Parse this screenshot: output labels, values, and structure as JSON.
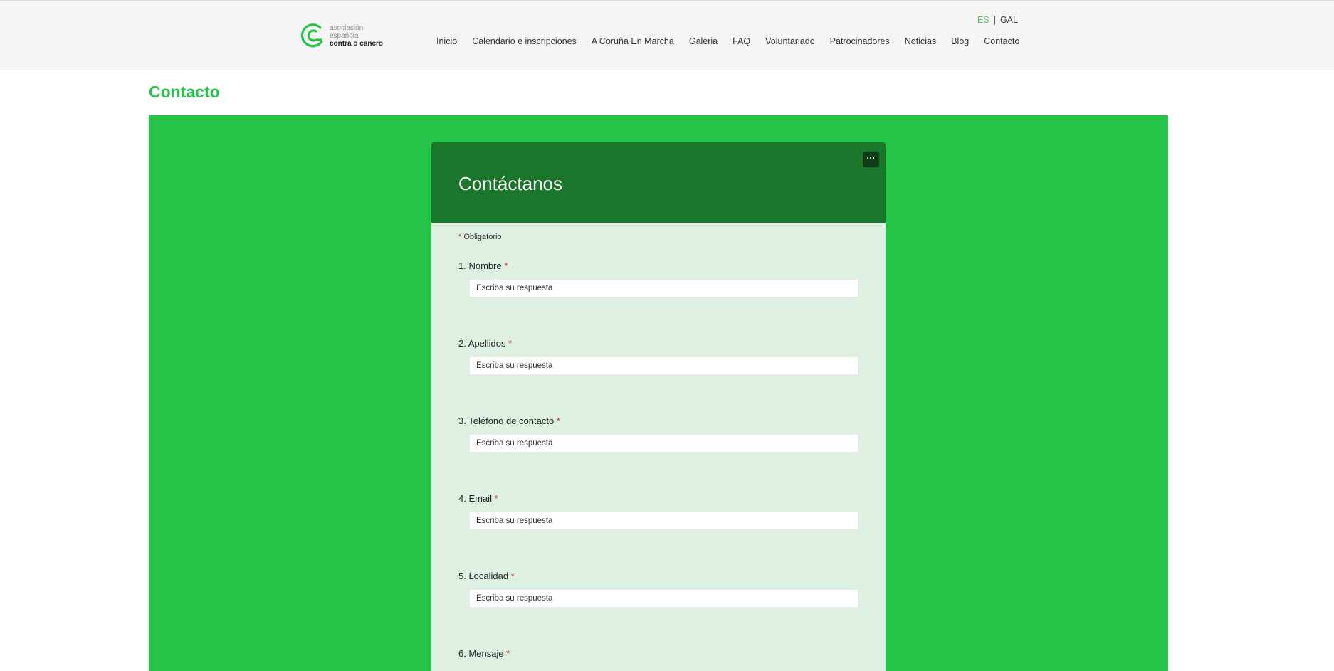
{
  "logo": {
    "line1": "asociación",
    "line2": "española",
    "line3": "contra o cancro",
    "brand_color": "#27c24a"
  },
  "language": {
    "active": "ES",
    "separator": "|",
    "other": "GAL"
  },
  "nav": [
    "Inicio",
    "Calendario e inscripciones",
    "A Coruña En Marcha",
    "Galeria",
    "FAQ",
    "Voluntariado",
    "Patrocinadores",
    "Noticias",
    "Blog",
    "Contacto"
  ],
  "page_title": "Contacto",
  "form": {
    "title": "Contáctanos",
    "more_label": "···",
    "required_star": "*",
    "required_note": "Obligatorio",
    "questions": [
      {
        "label": "1. Nombre",
        "placeholder": "Escriba su respuesta"
      },
      {
        "label": "2. Apellidos",
        "placeholder": "Escriba su respuesta"
      },
      {
        "label": "3. Teléfono de contacto",
        "placeholder": "Escriba su respuesta"
      },
      {
        "label": "4. Email",
        "placeholder": "Escriba su respuesta"
      },
      {
        "label": "5. Localidad",
        "placeholder": "Escriba su respuesta"
      },
      {
        "label": "6. Mensaje",
        "placeholder": ""
      }
    ],
    "header_color": "#1a762b",
    "body_color": "#ddf0e2",
    "band_color": "#26c449"
  }
}
